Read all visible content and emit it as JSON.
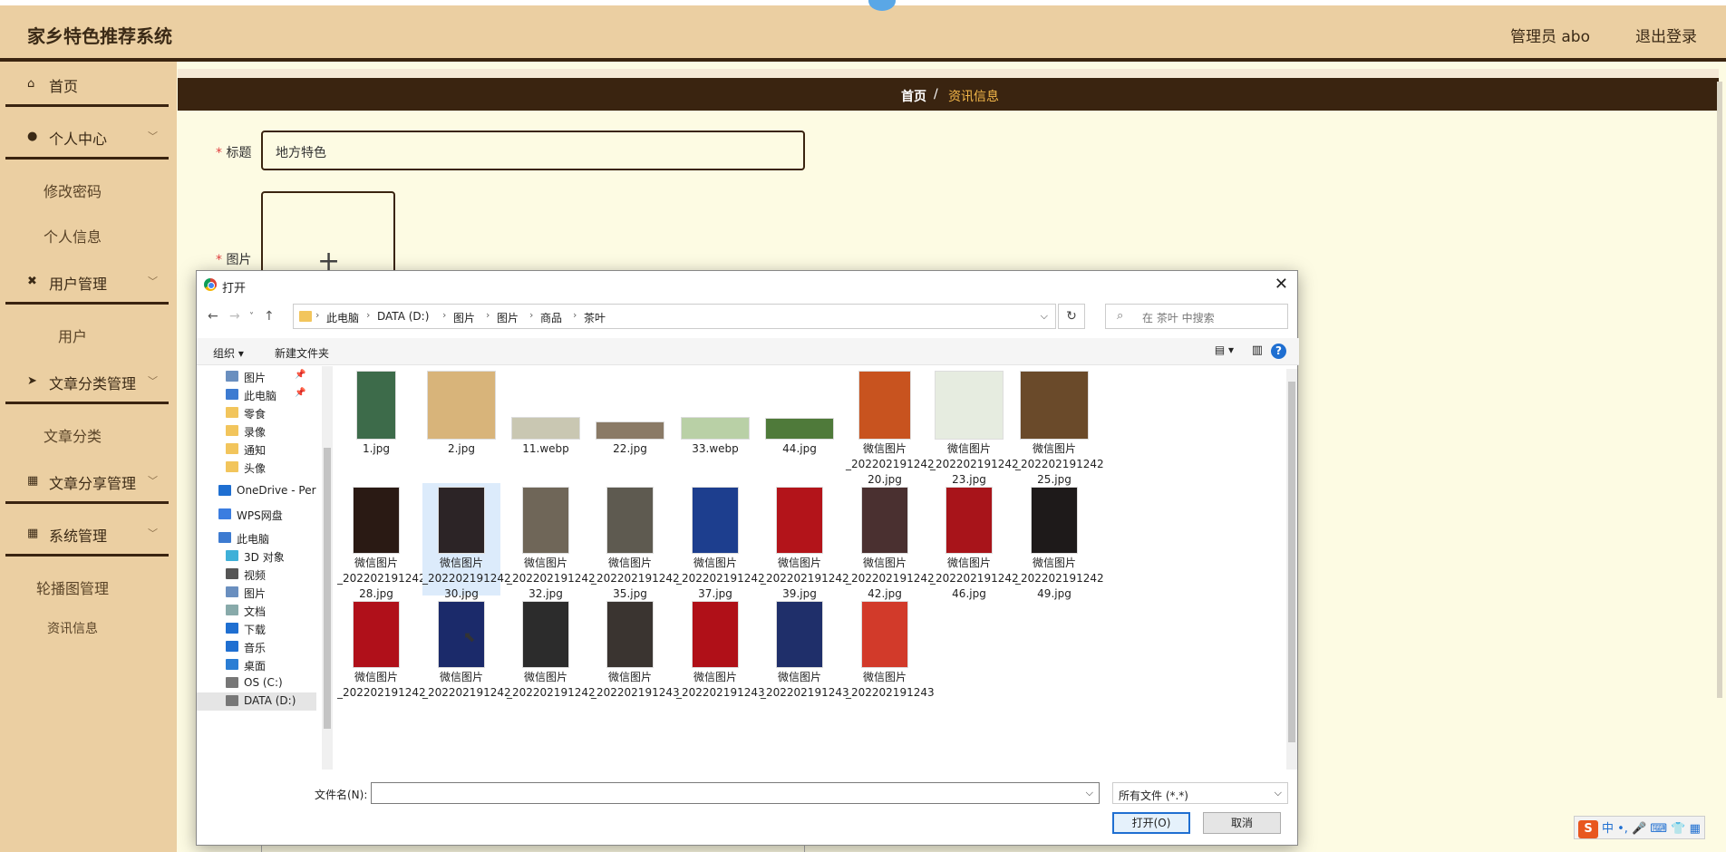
{
  "app": {
    "title": "家乡特色推荐系统",
    "admin": "管理员 abo",
    "logout": "退出登录"
  },
  "sidebar": {
    "home": "首页",
    "personal": "个人中心",
    "change_password": "修改密码",
    "personal_info": "个人信息",
    "user_mgmt": "用户管理",
    "users": "用户",
    "article_cat_mgmt": "文章分类管理",
    "article_cat": "文章分类",
    "article_share_mgmt": "文章分享管理",
    "system_mgmt": "系统管理",
    "carousel_mgmt": "轮播图管理",
    "news_info": "资讯信息"
  },
  "breadcrumb": {
    "home": "首页",
    "sep": "/",
    "current": "资讯信息"
  },
  "form": {
    "title_label": "标题",
    "title_value": "地方特色",
    "image_label": "图片",
    "required_mark": "*"
  },
  "dialog": {
    "title": "打开",
    "path": [
      "此电脑",
      "DATA (D:)",
      "图片",
      "图片",
      "商品",
      "茶叶"
    ],
    "search_placeholder": "在 茶叶 中搜索",
    "organize": "组织 ▾",
    "new_folder": "新建文件夹",
    "nav_items": [
      {
        "label": "图片",
        "icon": "pictures-icon",
        "pinned": true
      },
      {
        "label": "此电脑",
        "icon": "computer-icon",
        "pinned": true
      },
      {
        "label": "零食",
        "icon": "folder-icon"
      },
      {
        "label": "录像",
        "icon": "folder-icon"
      },
      {
        "label": "通知",
        "icon": "folder-icon"
      },
      {
        "label": "头像",
        "icon": "folder-icon"
      },
      {
        "label": "OneDrive - Perso",
        "icon": "onedrive-icon"
      },
      {
        "label": "WPS网盘",
        "icon": "wps-cloud-icon"
      },
      {
        "label": "此电脑",
        "icon": "computer-icon"
      },
      {
        "label": "3D 对象",
        "icon": "3d-objects-icon"
      },
      {
        "label": "视频",
        "icon": "videos-icon"
      },
      {
        "label": "图片",
        "icon": "pictures-icon"
      },
      {
        "label": "文档",
        "icon": "documents-icon"
      },
      {
        "label": "下载",
        "icon": "downloads-icon"
      },
      {
        "label": "音乐",
        "icon": "music-icon"
      },
      {
        "label": "桌面",
        "icon": "desktop-icon"
      },
      {
        "label": "OS (C:)",
        "icon": "drive-icon"
      },
      {
        "label": "DATA (D:)",
        "icon": "drive-icon"
      }
    ],
    "files": [
      {
        "name": "1.jpg",
        "color": "#3d6b4a"
      },
      {
        "name": "2.jpg",
        "color": "#d8b47a"
      },
      {
        "name": "11.webp",
        "color": "#c9c7b2"
      },
      {
        "name": "22.jpg",
        "color": "#8a7a66"
      },
      {
        "name": "33.webp",
        "color": "#b9d0a6"
      },
      {
        "name": "44.jpg",
        "color": "#4f7a3a"
      },
      {
        "name": "微信图片\n_202202191242\n20.jpg",
        "color": "#c8531f"
      },
      {
        "name": "微信图片\n_202202191242\n23.jpg",
        "color": "#e6ece0"
      },
      {
        "name": "微信图片\n_202202191242\n25.jpg",
        "color": "#6a4a2a"
      },
      {
        "name": "微信图片\n_202202191242\n28.jpg",
        "color": "#2a1a14"
      },
      {
        "name": "微信图片\n_202202191242\n30.jpg",
        "color": "#2c2426"
      },
      {
        "name": "微信图片\n_202202191242\n32.jpg",
        "color": "#6f6658"
      },
      {
        "name": "微信图片\n_202202191242\n35.jpg",
        "color": "#5e5a50"
      },
      {
        "name": "微信图片\n_202202191242\n37.jpg",
        "color": "#1d3e8e"
      },
      {
        "name": "微信图片\n_202202191242\n39.jpg",
        "color": "#b3141a"
      },
      {
        "name": "微信图片\n_202202191242\n42.jpg",
        "color": "#4a3030"
      },
      {
        "name": "微信图片\n_202202191242\n46.jpg",
        "color": "#a8141a"
      },
      {
        "name": "微信图片\n_202202191242\n49.jpg",
        "color": "#1e1a1a"
      },
      {
        "name": "微信图片\n_202202191242",
        "color": "#b0101a"
      },
      {
        "name": "微信图片\n_202202191242",
        "color": "#1b2a6a"
      },
      {
        "name": "微信图片\n_202202191242",
        "color": "#2c2c2c"
      },
      {
        "name": "微信图片\n_202202191243",
        "color": "#3a3430"
      },
      {
        "name": "微信图片\n_202202191243",
        "color": "#b01018"
      },
      {
        "name": "微信图片\n_202202191243",
        "color": "#1f2f6a"
      },
      {
        "name": "微信图片\n_202202191243",
        "color": "#d23a2a"
      }
    ],
    "selected_file_index": 10,
    "filename_label": "文件名(N):",
    "filename_value": "",
    "filetype": "所有文件 (*.*)",
    "open_button": "打开(O)",
    "cancel_button": "取消"
  },
  "ime": {
    "labels": "中 •, 🎤 ⌨ 👕 ▦"
  }
}
